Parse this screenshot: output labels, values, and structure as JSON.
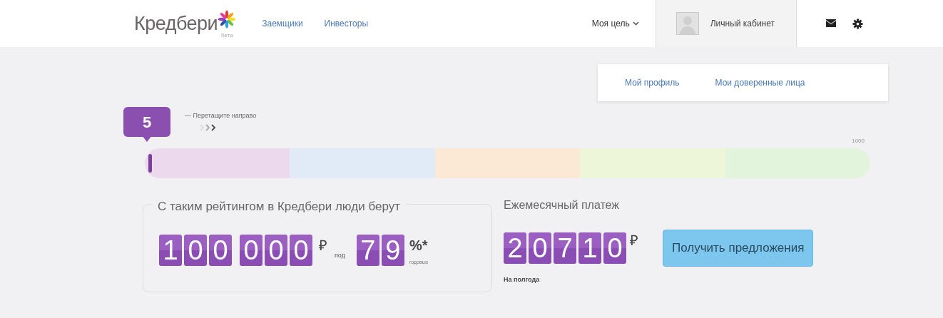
{
  "header": {
    "logo": {
      "text": "Кредбери",
      "subtitle": "бета"
    },
    "nav": [
      {
        "label": "Заемщики"
      },
      {
        "label": "Инвесторы"
      }
    ],
    "goal_menu": {
      "label": "Моя цель"
    },
    "account": {
      "label": "Личный кабинет",
      "expanded": true
    },
    "account_menu": [
      {
        "label": "Мой профиль"
      },
      {
        "label": "Мои доверенные лица"
      }
    ]
  },
  "rating_slider": {
    "value": "5",
    "hint": "— Перетащите направо",
    "max_label": "1000",
    "level": 0.005,
    "segments": [
      {
        "color": "#ecd9ee"
      },
      {
        "color": "#e1ebf7"
      },
      {
        "color": "#fbe9d6"
      },
      {
        "color": "#eef6d9"
      },
      {
        "color": "#e2f5dc"
      }
    ]
  },
  "offer": {
    "title": "С таким рейтингом в Кредбери люди берут",
    "amount_groups": [
      [
        "1",
        "0",
        "0"
      ],
      [
        "0",
        "0",
        "0"
      ]
    ],
    "currency": "₽",
    "connector": "под",
    "rate_digits": [
      "7",
      "9"
    ],
    "rate_unit": "%*",
    "rate_note": "годовых"
  },
  "payment": {
    "title": "Ежемесячный платеж",
    "digits": [
      "2",
      "0",
      "7",
      "1",
      "0"
    ],
    "currency": "₽",
    "period": "На полгода"
  },
  "cta_button": {
    "label": "Получить предложения"
  }
}
